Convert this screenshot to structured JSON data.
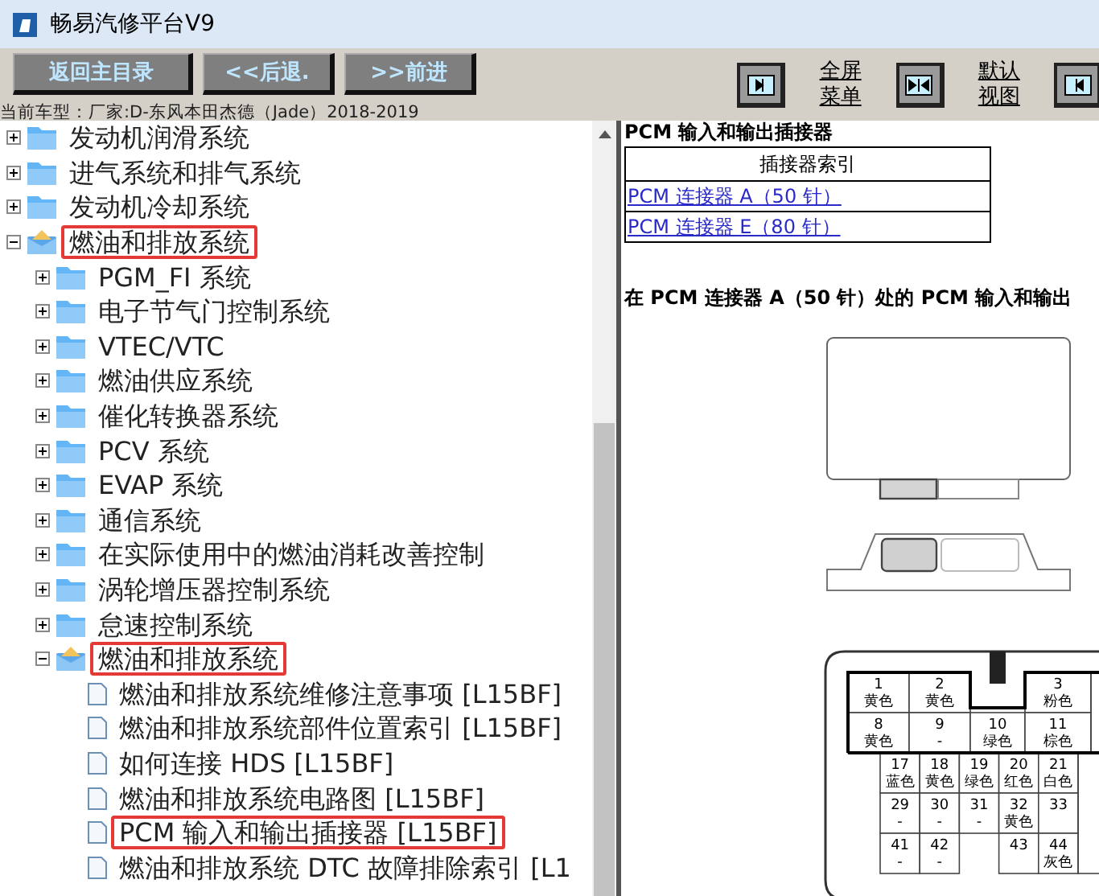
{
  "window": {
    "title": "畅易汽修平台V9"
  },
  "toolbar": {
    "nav_buttons": [
      "返回主目录",
      "<<后退.",
      ">>前进"
    ],
    "view_links": [
      "全屏菜单",
      "默认视图"
    ]
  },
  "current_vehicle": "当前车型：厂家:D-东风本田杰德（Jade）2018-2019",
  "tree": [
    {
      "label": "发动机润滑系统",
      "kind": "folder",
      "expanded": false,
      "marked": false
    },
    {
      "label": "进气系统和排气系统",
      "kind": "folder",
      "expanded": false,
      "marked": false
    },
    {
      "label": "发动机冷却系统",
      "kind": "folder",
      "expanded": false,
      "marked": false
    },
    {
      "label": "燃油和排放系统",
      "kind": "folder",
      "expanded": true,
      "marked": true,
      "children": [
        {
          "label": "PGM_FI 系统",
          "kind": "folder",
          "expanded": false,
          "marked": false
        },
        {
          "label": "电子节气门控制系统",
          "kind": "folder",
          "expanded": false,
          "marked": false
        },
        {
          "label": "VTEC/VTC",
          "kind": "folder",
          "expanded": false,
          "marked": false
        },
        {
          "label": "燃油供应系统",
          "kind": "folder",
          "expanded": false,
          "marked": false
        },
        {
          "label": "催化转换器系统",
          "kind": "folder",
          "expanded": false,
          "marked": false
        },
        {
          "label": "PCV 系统",
          "kind": "folder",
          "expanded": false,
          "marked": false
        },
        {
          "label": "EVAP 系统",
          "kind": "folder",
          "expanded": false,
          "marked": false
        },
        {
          "label": "通信系统",
          "kind": "folder",
          "expanded": false,
          "marked": false
        },
        {
          "label": "在实际使用中的燃油消耗改善控制",
          "kind": "folder",
          "expanded": false,
          "marked": false
        },
        {
          "label": "涡轮增压器控制系统",
          "kind": "folder",
          "expanded": false,
          "marked": false
        },
        {
          "label": "怠速控制系统",
          "kind": "folder",
          "expanded": false,
          "marked": false
        },
        {
          "label": "燃油和排放系统",
          "kind": "folder",
          "expanded": true,
          "marked": true,
          "children": [
            {
              "label": "燃油和排放系统维修注意事项 [L15BF]",
              "kind": "document",
              "marked": false
            },
            {
              "label": "燃油和排放系统部件位置索引 [L15BF]",
              "kind": "document",
              "marked": false
            },
            {
              "label": "如何连接 HDS [L15BF]",
              "kind": "document",
              "marked": false
            },
            {
              "label": "燃油和排放系统电路图 [L15BF]",
              "kind": "document",
              "marked": false
            },
            {
              "label": "PCM 输入和输出插接器 [L15BF]",
              "kind": "document",
              "marked": true
            },
            {
              "label": "燃油和排放系统 DTC 故障排除索引 [L1",
              "kind": "document",
              "marked": false
            }
          ]
        }
      ]
    }
  ],
  "document": {
    "heading": "PCM 输入和输出插接器",
    "index_table": {
      "header": "插接器索引",
      "links": [
        "PCM 连接器 A（50 针）",
        "PCM 连接器 E（80 针）"
      ]
    },
    "section_title": "在 PCM 连接器 A（50 针）处的 PCM 输入和输出",
    "pin_rows": [
      [
        {
          "number": "1",
          "wire": "黄色"
        },
        {
          "number": "2",
          "wire": "黄色"
        },
        {
          "number": "3",
          "wire": "粉色"
        }
      ],
      [
        {
          "number": "8",
          "wire": "黄色"
        },
        {
          "number": "9",
          "wire": "-"
        },
        {
          "number": "10",
          "wire": "绿色"
        },
        {
          "number": "11",
          "wire": "棕色"
        }
      ],
      [
        {
          "number": "17",
          "wire": "蓝色"
        },
        {
          "number": "18",
          "wire": "黄色"
        },
        {
          "number": "19",
          "wire": "绿色"
        },
        {
          "number": "20",
          "wire": "红色"
        },
        {
          "number": "21",
          "wire": "白色"
        }
      ],
      [
        {
          "number": "29",
          "wire": "-"
        },
        {
          "number": "30",
          "wire": "-"
        },
        {
          "number": "31",
          "wire": "-"
        },
        {
          "number": "32",
          "wire": "黄色"
        },
        {
          "number": "33"
        }
      ],
      [
        {
          "number": "41",
          "wire": "-"
        },
        {
          "number": "42",
          "wire": "-"
        },
        {
          "number": "43"
        },
        {
          "number": "44",
          "wire": "灰色"
        }
      ]
    ]
  }
}
